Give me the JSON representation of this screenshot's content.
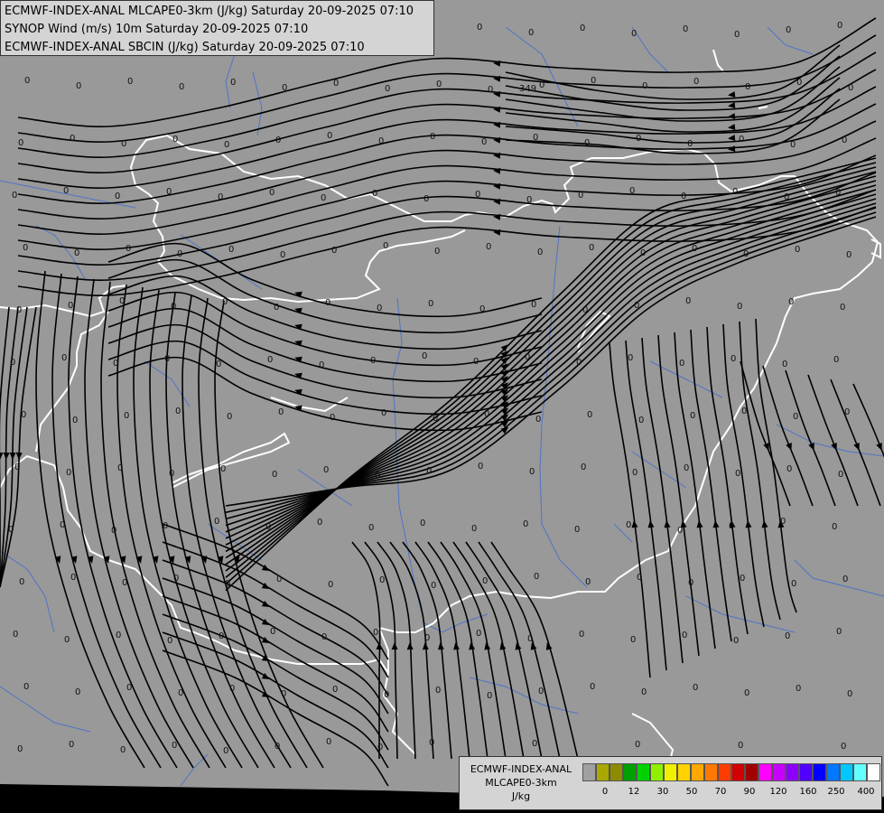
{
  "header": {
    "lines": [
      "ECMWF-INDEX-ANAL MLCAPE0-3km (J/kg) Saturday 20-09-2025 07:10",
      "SYNOP Wind (m/s) 10m Saturday 20-09-2025 07:10",
      "ECMWF-INDEX-ANAL SBCIN (J/kg) Saturday 20-09-2025 07:10"
    ]
  },
  "legend": {
    "title_lines": [
      "ECMWF-INDEX-ANAL",
      "MLCAPE0-3km",
      "J/kg"
    ],
    "colors": [
      "#a0a0a0",
      "#a8a800",
      "#8c8c00",
      "#00a000",
      "#00d200",
      "#90f000",
      "#f0f000",
      "#ffd200",
      "#ffa800",
      "#ff7800",
      "#ff3c00",
      "#d20000",
      "#a00000",
      "#ff00ff",
      "#c800ff",
      "#8c00ff",
      "#5000ff",
      "#0000ff",
      "#0078ff",
      "#00c8ff",
      "#64ffff",
      "#ffffff"
    ],
    "tick_labels": [
      "0",
      "12",
      "30",
      "50",
      "70",
      "90",
      "120",
      "160",
      "250",
      "400"
    ]
  },
  "map": {
    "background_color": "#999999",
    "border_color": "#ffffff",
    "river_color": "#4f74c6",
    "streamline_color": "#000000",
    "station_values": [
      "0",
      "349"
    ]
  }
}
